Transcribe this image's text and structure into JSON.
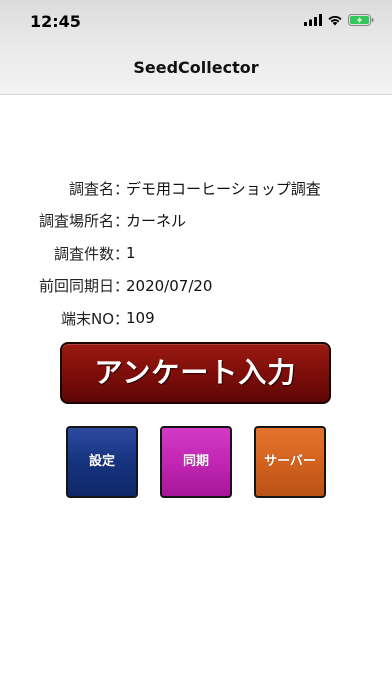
{
  "status_bar": {
    "time": "12:45",
    "icons": [
      "cellular-signal-icon",
      "wifi-icon",
      "battery-charging-icon"
    ]
  },
  "nav": {
    "title": "SeedCollector"
  },
  "info": {
    "colon": "：",
    "rows": [
      {
        "label": "調査名",
        "value": "デモ用コーヒーショップ調査"
      },
      {
        "label": "調査場所名",
        "value": "カーネル"
      },
      {
        "label": "調査件数",
        "value": "1"
      },
      {
        "label": "前回同期日",
        "value": "2020/07/20"
      },
      {
        "label": "端末NO",
        "value": "109"
      }
    ]
  },
  "actions": {
    "survey_input": "アンケート入力",
    "settings": "設定",
    "sync": "同期",
    "server": "サーバー"
  },
  "colors": {
    "survey_button": "#7e0e0a",
    "settings_button": "#16337f",
    "sync_button": "#c226b4",
    "server_button": "#d4621e",
    "battery_charging": "#34c759"
  }
}
